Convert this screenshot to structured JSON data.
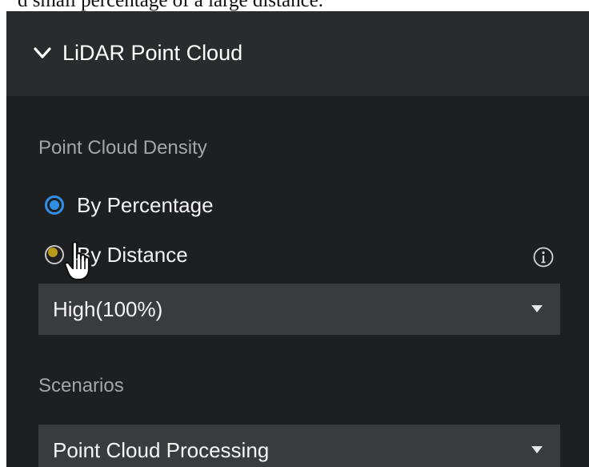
{
  "caption": {
    "text": "d small percentage of a large distance."
  },
  "panel": {
    "title": "LiDAR Point Cloud",
    "icons": {
      "collapse": "chevron-down-icon",
      "info": "info-icon",
      "cursor": "hand-pointer-cursor"
    },
    "colors": {
      "panel_bg": "#1e1f21",
      "header_bg": "#2a2b2d",
      "select_bg": "#3a3b3d",
      "accent": "#2f8fe6",
      "label": "#a3a5a8"
    }
  },
  "density": {
    "label": "Point Cloud Density",
    "options": [
      {
        "label": "By Percentage",
        "selected": true
      },
      {
        "label": "By Distance",
        "selected": false
      }
    ],
    "select_value": "High(100%)"
  },
  "scenarios": {
    "label": "Scenarios",
    "select_value": "Point Cloud Processing"
  }
}
